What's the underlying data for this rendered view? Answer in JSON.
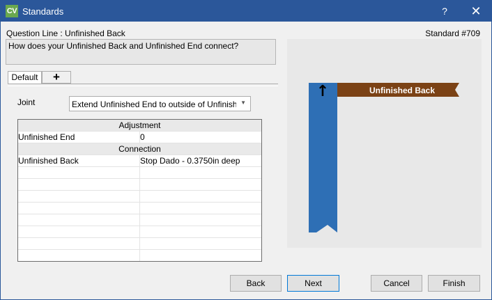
{
  "window": {
    "title": "Standards",
    "icon_text": "CV",
    "help_label": "?",
    "close_label": "✕"
  },
  "header": {
    "question_line": "Question Line : Unfinished Back",
    "standard_number": "Standard #709"
  },
  "question": {
    "text": "How does your Unfinished Back and Unfinished End connect?"
  },
  "tabs": [
    {
      "label": "Default"
    },
    {
      "label": "+"
    }
  ],
  "joint": {
    "label": "Joint",
    "selected": "Extend Unfinished End to outside of Unfinished Back"
  },
  "grid": {
    "adjustment_header": "Adjustment",
    "adjustment_rows": [
      {
        "name": "Unfinished End",
        "value": "0"
      }
    ],
    "connection_header": "Connection",
    "connection_rows": [
      {
        "name": "Unfinished Back",
        "value": "Stop Dado - 0.3750in deep"
      }
    ]
  },
  "preview": {
    "back_label": "Unfinished Back",
    "arrow_glyph": "↑",
    "colors": {
      "end_panel": "#2e6fb5",
      "back_panel": "#7b4215",
      "background": "#e8e8e8"
    }
  },
  "buttons": {
    "back": "Back",
    "next": "Next",
    "cancel": "Cancel",
    "finish": "Finish"
  }
}
